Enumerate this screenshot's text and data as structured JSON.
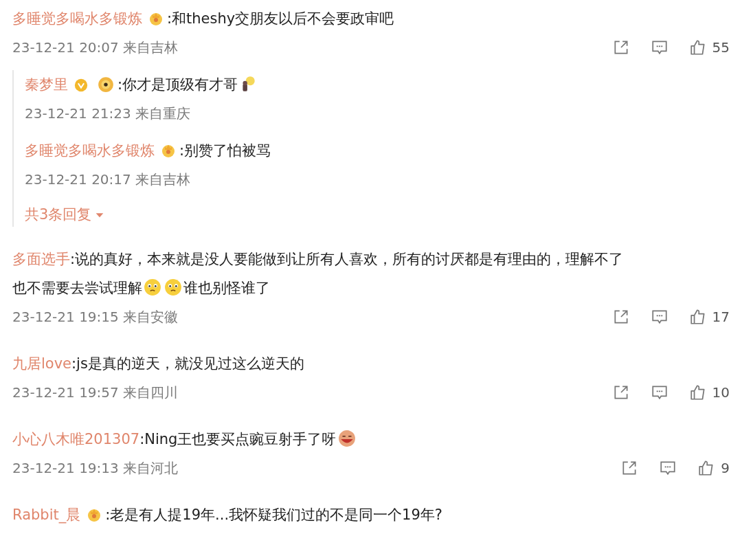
{
  "comments": [
    {
      "user": "多睡觉多喝水多锻炼",
      "badges": [
        {
          "kind": "fan"
        }
      ],
      "content": [
        {
          "kind": "text",
          "text": ":和theshy交朋友以后不会要政审吧"
        }
      ],
      "time": "23-12-21 20:07",
      "location": "来自吉林",
      "likes": "55",
      "replies": [
        {
          "user": "秦梦里",
          "badges": [
            {
              "kind": "verified"
            },
            {
              "kind": "lion"
            }
          ],
          "content": [
            {
              "kind": "text",
              "text": ":你才是顶级有才哥"
            },
            {
              "kind": "bulb"
            }
          ],
          "time": "23-12-21 21:23",
          "location": "来自重庆"
        },
        {
          "user": "多睡觉多喝水多锻炼",
          "badges": [
            {
              "kind": "fan"
            }
          ],
          "content": [
            {
              "kind": "text",
              "text": ":别赞了怕被骂"
            }
          ],
          "time": "23-12-21 20:17",
          "location": "来自吉林"
        }
      ],
      "more_replies": "共3条回复"
    },
    {
      "user": "多面选手",
      "content": [
        {
          "kind": "text",
          "text": ":说的真好，本来就是没人要能做到让所有人喜欢，所有的讨厌都是有理由的，理解不了"
        },
        {
          "kind": "text",
          "text": "也不需要去尝试理解"
        },
        {
          "kind": "sad"
        },
        {
          "kind": "sad"
        },
        {
          "kind": "text",
          "text": "谁也别怪谁了"
        }
      ],
      "time": "23-12-21 19:15",
      "location": "来自安徽",
      "likes": "17"
    },
    {
      "user": "九居love",
      "content": [
        {
          "kind": "text",
          "text": ":js是真的逆天，就没见过这么逆天的"
        }
      ],
      "time": "23-12-21 19:57",
      "location": "来自四川",
      "likes": "10"
    },
    {
      "user": "小心八木唯201307",
      "content": [
        {
          "kind": "text",
          "text": ":Ning王也要买点豌豆射手了呀"
        },
        {
          "kind": "laugh"
        }
      ],
      "time": "23-12-21 19:13",
      "location": "来自河北",
      "likes": "9"
    },
    {
      "user": "Rabbit_晨",
      "badges": [
        {
          "kind": "fan"
        }
      ],
      "content": [
        {
          "kind": "text",
          "text": ":老是有人提19年...我怀疑我们过的不是同一个19年?"
        }
      ]
    }
  ]
}
